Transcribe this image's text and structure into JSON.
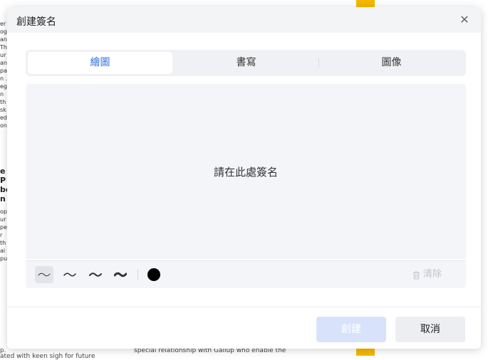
{
  "background": {
    "left_fragments": [
      "er",
      "og",
      "an",
      "Th",
      "ur",
      "an",
      "pa",
      "n .",
      "eg",
      "n",
      "th",
      "sk",
      "ed",
      "on"
    ],
    "left_bold_fragments": [
      "e",
      "P",
      "be",
      "n"
    ],
    "left_lower_fragments": [
      "op",
      "ur",
      "pe",
      "r",
      "th",
      "ai",
      "pu"
    ],
    "bottom_left_text": "p.",
    "bottom_left_text_2": "ated with keen sigh for future",
    "bottom_mid_text": "special relationship with Gallup who enable the",
    "accent_color": "#f5b700"
  },
  "dialog": {
    "title": "創建簽名",
    "close_icon": "close-icon",
    "tabs": [
      {
        "label": "繪圖",
        "active": true
      },
      {
        "label": "書寫",
        "active": false
      },
      {
        "label": "圖像",
        "active": false
      }
    ],
    "canvas": {
      "placeholder": "請在此處簽名"
    },
    "toolbar": {
      "stroke_widths": [
        "thin",
        "medium",
        "thick",
        "extra-thick"
      ],
      "selected_stroke": "thin",
      "pen_color": "#000000",
      "clear_label": "清除",
      "clear_icon": "trash-icon"
    },
    "buttons": {
      "create": "創建",
      "cancel": "取消"
    },
    "active_color": "#2f6fe0"
  }
}
